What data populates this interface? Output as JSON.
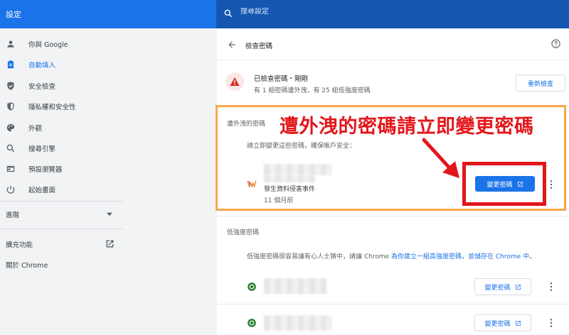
{
  "header": {
    "title": "設定",
    "search_placeholder": "搜尋設定"
  },
  "sidebar": {
    "items": [
      {
        "label": "你與 Google",
        "icon": "person-icon"
      },
      {
        "label": "自動填入",
        "icon": "clipboard-icon",
        "active": true
      },
      {
        "label": "安全檢查",
        "icon": "shield-check-icon"
      },
      {
        "label": "隱私權和安全性",
        "icon": "shield-icon"
      },
      {
        "label": "外觀",
        "icon": "palette-icon"
      },
      {
        "label": "搜尋引擎",
        "icon": "search-icon"
      },
      {
        "label": "預設瀏覽器",
        "icon": "browser-icon"
      },
      {
        "label": "起始畫面",
        "icon": "power-icon"
      }
    ],
    "advanced_label": "進階",
    "extensions_label": "擴充功能",
    "about_label": "關於 Chrome"
  },
  "page": {
    "title": "檢查密碼",
    "status_title": "已檢查密碼・剛剛",
    "status_sub": "有 1 組密碼遭外洩，有 25 組低強度密碼",
    "recheck_label": "重新檢查"
  },
  "leaked": {
    "section_label": "遭外洩的密碼",
    "desc": "請立即變更這些密碼，確保帳戶安全：",
    "item_status": "發生資料侵害事件",
    "item_time": "11 個月前",
    "change_label": "變更密碼"
  },
  "weak": {
    "section_label": "低強度密碼",
    "desc_prefix": "低強度密碼很容易讓有心人士猜中，請讓 Chrome ",
    "desc_link": "為你建立一組高強度密碼，並儲存在 Chrome 中",
    "desc_suffix": "。",
    "change_label": "變更密碼"
  },
  "annotation": {
    "text": "遭外洩的密碼請立即變更密碼"
  },
  "colors": {
    "header": "#1a73e8",
    "accent": "#1a73e8",
    "annotation_red": "#e3161b",
    "annotation_orange": "#f6a94a"
  }
}
